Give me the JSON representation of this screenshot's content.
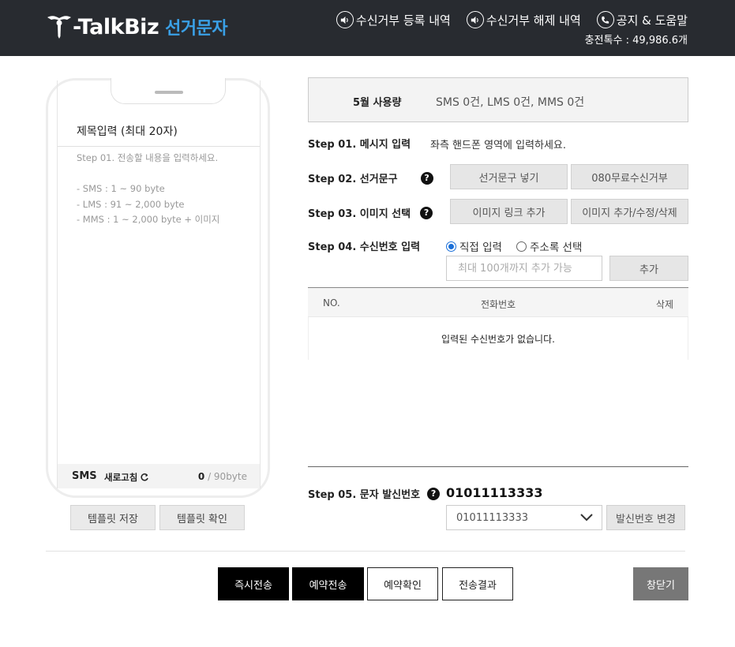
{
  "header": {
    "brand": "-TalkBiz",
    "subtitle": "선거문자",
    "nav": [
      {
        "label": "수신거부 등록 내역",
        "icon": "speaker-icon"
      },
      {
        "label": "수신거부 해제 내역",
        "icon": "speaker-icon"
      },
      {
        "label": "공지 & 도움말",
        "icon": "phone-icon"
      }
    ],
    "balance": "충전톡수 : 49,986.6개"
  },
  "phone": {
    "title_placeholder": "제목입력 (최대 20자)",
    "guide": {
      "intro": "Step 01. 전송할 내용을 입력하세요.",
      "sms": "- SMS : 1 ~ 90 byte",
      "lms": "- LMS : 91 ~ 2,000 byte",
      "mms": "- MMS : 1 ~ 2,000 byte + 이미지"
    },
    "footer": {
      "type": "SMS",
      "refresh": "새로고침",
      "count_current": "0",
      "count_max": " / 90byte"
    }
  },
  "template_buttons": {
    "save": "템플릿 저장",
    "view": "템플릿 확인"
  },
  "usage": {
    "title": "5월 사용량",
    "value": "SMS 0건,  LMS 0건,  MMS 0건"
  },
  "steps": {
    "step1": {
      "label": "Step 01. 메시지 입력",
      "note": "좌측 핸드폰 영역에 입력하세요."
    },
    "step2": {
      "label": "Step 02. 선거문구",
      "btn1": "선거문구 넣기",
      "btn2": "080무료수신거부"
    },
    "step3": {
      "label": "Step 03. 이미지 선택",
      "btn1": "이미지 링크 추가",
      "btn2": "이미지 추가/수정/삭제"
    },
    "step4": {
      "label": "Step 04. 수신번호 입력",
      "radio_direct": "직접 입력",
      "radio_addressbook": "주소록 선택",
      "input_placeholder": "최대 100개까지 추가 가능",
      "add_button": "추가"
    },
    "step5": {
      "label": "Step 05. 문자 발신번호",
      "sender_number": "01011113333",
      "selected_option": "01011113333",
      "change_button": "발신번호 변경"
    }
  },
  "table": {
    "col_no": "NO.",
    "col_phone": "전화번호",
    "col_delete": "삭제",
    "empty_message": "입력된 수신번호가 없습니다."
  },
  "actions": {
    "send_now": "즉시전송",
    "reserve": "예약전송",
    "reserve_check": "예약확인",
    "send_result": "전송결과",
    "close": "창닫기"
  },
  "colors": {
    "header_bg": "#282b30",
    "brand_sub": "#3aa0e6",
    "radio_on": "#1a6fd8"
  }
}
